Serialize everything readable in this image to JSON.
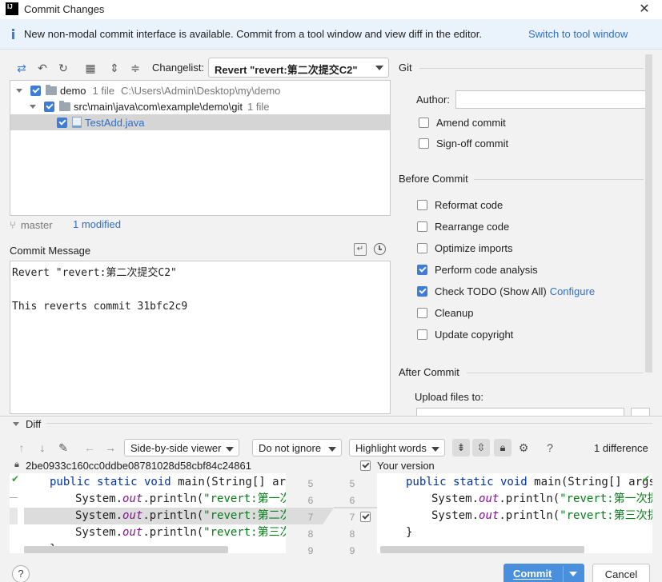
{
  "window": {
    "title": "Commit Changes",
    "logo": "IJ"
  },
  "banner": {
    "text": "New non-modal commit interface is available. Commit from a tool window and view diff in the editor.",
    "link": "Switch to tool window"
  },
  "toolbar": {
    "changelist_label": "Changelist:",
    "changelist_value": "Revert \"revert:第二次提交C2\""
  },
  "tree": {
    "root": {
      "name": "demo",
      "count": "1 file",
      "path": "C:\\Users\\Admin\\Desktop\\my\\demo"
    },
    "folder": {
      "name": "src\\main\\java\\com\\example\\demo\\git",
      "count": "1 file"
    },
    "file": {
      "name": "TestAdd.java"
    }
  },
  "branch": {
    "name": "master",
    "modified": "1 modified"
  },
  "commit_message": {
    "label": "Commit Message",
    "text": "Revert \"revert:第二次提交C2\"\n\nThis reverts commit 31bfc2c9"
  },
  "git": {
    "title": "Git",
    "author_label": "Author:",
    "author_value": "",
    "amend": "Amend commit",
    "signoff": "Sign-off commit"
  },
  "before_commit": {
    "title": "Before Commit",
    "options": [
      {
        "label": "Reformat code",
        "checked": false
      },
      {
        "label": "Rearrange code",
        "checked": false
      },
      {
        "label": "Optimize imports",
        "checked": false
      },
      {
        "label": "Perform code analysis",
        "checked": true
      },
      {
        "label": "Check TODO (Show All)",
        "checked": true,
        "link": "Configure"
      },
      {
        "label": "Cleanup",
        "checked": false
      },
      {
        "label": "Update copyright",
        "checked": false
      }
    ]
  },
  "after_commit": {
    "title": "After Commit",
    "upload_label": "Upload files to:"
  },
  "diff": {
    "title": "Diff",
    "viewer": "Side-by-side viewer",
    "whitespace": "Do not ignore",
    "highlight": "Highlight words",
    "difference_count": "1 difference",
    "left_revision": "2be0933c160cc0ddbe08781028d58cbf84c24861",
    "right_revision": "Your version",
    "left_line_numbers": [
      "5",
      "6",
      "7",
      "8"
    ],
    "right_line_numbers": [
      "5",
      "6",
      "7",
      "8",
      "9"
    ],
    "left_lines": [
      {
        "indent": "    ",
        "kw": "public static void",
        "rest": " main(String[] args"
      },
      {
        "indent": "        ",
        "pre": "System.",
        "it": "out",
        "mid": ".println(",
        "str": "\"revert:第一次"
      },
      {
        "indent": "        ",
        "pre": "System.",
        "it": "out",
        "mid": ".println(",
        "str": "\"revert:第二次"
      },
      {
        "indent": "        ",
        "pre": "System.",
        "it": "out",
        "mid": ".println(",
        "str": "\"revert:第三次"
      },
      {
        "indent": "    ",
        "text": "}"
      }
    ],
    "right_lines": [
      {
        "indent": "    ",
        "kw": "public static void",
        "rest": " main(String[] args) {"
      },
      {
        "indent": "        ",
        "pre": "System.",
        "it": "out",
        "mid": ".println(",
        "str": "\"revert:第一次提交"
      },
      {
        "indent": "        ",
        "pre": "System.",
        "it": "out",
        "mid": ".println(",
        "str": "\"revert:第三次提交"
      },
      {
        "indent": "    ",
        "text": "}"
      }
    ]
  },
  "buttons": {
    "help": "?",
    "commit": "Commit",
    "cancel": "Cancel"
  },
  "colors": {
    "accent": "#3d7dd8",
    "link": "#2f6fca",
    "commit_button": "#4a8fdc",
    "banner_bg": "#eaf3fc"
  }
}
